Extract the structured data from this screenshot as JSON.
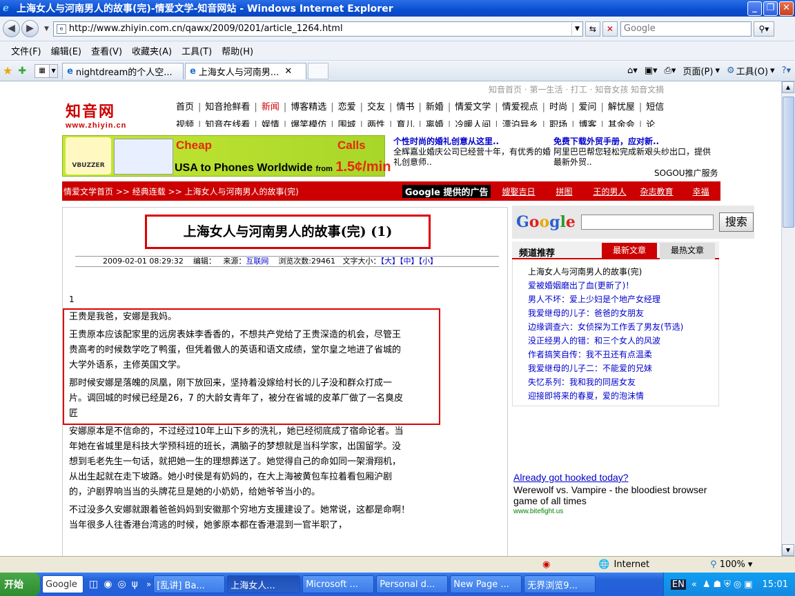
{
  "window": {
    "title": "上海女人与河南男人的故事(完)-情爱文学-知音网站 - Windows Internet Explorer"
  },
  "address": {
    "url": "http://www.zhiyin.com.cn/qawx/2009/0201/article_1264.html",
    "search_placeholder": "Google"
  },
  "menu": [
    "文件(F)",
    "编辑(E)",
    "查看(V)",
    "收藏夹(A)",
    "工具(T)",
    "帮助(H)"
  ],
  "tabs": [
    {
      "label": "nightdream的个人空..."
    },
    {
      "label": "上海女人与河南男..."
    }
  ],
  "toolbar": {
    "page": "页面(P)",
    "tools": "工具(O)"
  },
  "page": {
    "toplinks": "知音首页 · 第一生活 · 打工 · 知音女孩 知音文摘",
    "logo_cn": "知音网",
    "logo_url": "www.zhiyin.cn",
    "nav_row1": [
      "首页",
      "知音抢鲜看",
      "新闻",
      "博客精选",
      "恋爱",
      "交友",
      "情书",
      "新婚",
      "情爱文学",
      "情爱视点",
      "时尚",
      "爱问",
      "解忧屋",
      "短信"
    ],
    "nav_row2": [
      "视频",
      "知音在线看",
      "娱情",
      "爆笑模仿",
      "围城",
      "两性",
      "育儿",
      "离婚",
      "冷暖人间",
      "漂泊异乡",
      "职场",
      "博客",
      "其余会",
      "论"
    ],
    "banner": {
      "brand": "VBUZZER",
      "cheap": "Cheap",
      "calls": "Calls",
      "line": "USA to Phones Worldwide",
      "from": "from",
      "price": "1.5¢/min"
    },
    "sogou": {
      "h1": "全辉嘉业婚庆公司已经营十年，有优秀的婚礼创意师..",
      "t1": "全辉嘉业婚庆公司已经营十年，有优秀的婚礼创意师..",
      "h1_title": "个性时尚的婚礼创意从这里..",
      "h2_title": "免费下载外贸手册，应对新..",
      "t2": "阿里巴巴帮您轻松完成新艰头纱出口，提供最新外贸..",
      "foot": "SOGOU推广服务"
    },
    "breadcrumb": "情爱文学首页 >> 经典连载 >> 上海女人与河南男人的故事(完)",
    "google_ads_label": "Google 提供的广告",
    "ad_links": [
      "嫂娶吉日",
      "拼图",
      "王的男人",
      "杂志教育",
      "幸福"
    ],
    "article": {
      "title": "上海女人与河南男人的故事(完) (1)",
      "date": "2009-02-01 08:29:32",
      "editor": "编辑：",
      "source_label": "来源：",
      "source": "互联网",
      "views": "浏览次数:29461",
      "fontsize": "文字大小：",
      "big": "【大】",
      "mid": "【中】",
      "small": "【小】",
      "num": "1",
      "p1": "王贵是我爸，安娜是我妈。",
      "p2": "王贵原本应该配家里的远房表妹李香香的，不想共产党给了王贵深造的机会，尽管王贵高考的时候数学吃了鸭蛋，但凭着傲人的英语和语文成绩，堂尔皇之地进了省城的大学外语系，主修英国文学。",
      "p3": "那时候安娜是落魄的凤凰，刚下放回来，坚持着没嫁给村长的儿子没和群众打成一片。调回城的时候已经是26，7 的大龄女青年了，被分在省城的皮革厂做了一名臭皮匠",
      "p4": "安娜原本是不信命的，不过经过10年上山下乡的洗礼，她已经彻底成了宿命论者。当年她在省城里是科技大学预科班的班长，满脑子的梦想就是当科学家，出国留学。没想到毛老先生一句话，就把她一生的理想葬送了。她觉得自己的命如同一架滑翔机，从出生起就在走下坡路。她小时侯是有奶妈的，在大上海被黄包车拉着看包厢沪剧的，沪剧界响当当的头牌花旦是她的小奶奶，给她爷爷当小的。",
      "p5": "不过没多久安娜就跟着爸爸妈妈到安徽那个穷地方支援建设了。她常说，这都是命啊！当年很多人往香港台湾逃的时候，她爹原本都在香港混到一官半职了，"
    },
    "sidebar": {
      "search_btn": "搜索",
      "tab0": "频道推荐",
      "tab1": "最新文章",
      "tab2": "最热文章",
      "items": [
        "上海女人与河南男人的故事(完)",
        "爱被婚姻磨出了血(更新了)！",
        "男人不坏：爱上少妇是个地产女经理",
        "我爱继母的儿子：爸爸的女朋友",
        "边缘调查六：女侦探为工作丢了男友(节选)",
        "没正经男人的错：和三个女人的风波",
        "作者搞笑自传：我不丑还有点温柔",
        "我爱继母的儿子二：不能爱的兄妹",
        "失忆系列：我和我的同居女友",
        "迎接即将来的春夏，爱的泡沫情"
      ]
    },
    "gad": {
      "link": "Already got hooked today?",
      "text": "Werewolf vs. Vampire - the bloodiest browser game of all times",
      "url": "www.bitefight.us"
    }
  },
  "status": {
    "zone": "Internet",
    "zoom": "100%"
  },
  "taskbar": {
    "start": "开始",
    "google": "Google",
    "items": [
      "[乱讲] Ba...",
      "上海女人...",
      "Microsoft ...",
      "Personal d...",
      "New Page ...",
      "无界浏览9..."
    ],
    "time": "15:01",
    "lang": "EN"
  }
}
